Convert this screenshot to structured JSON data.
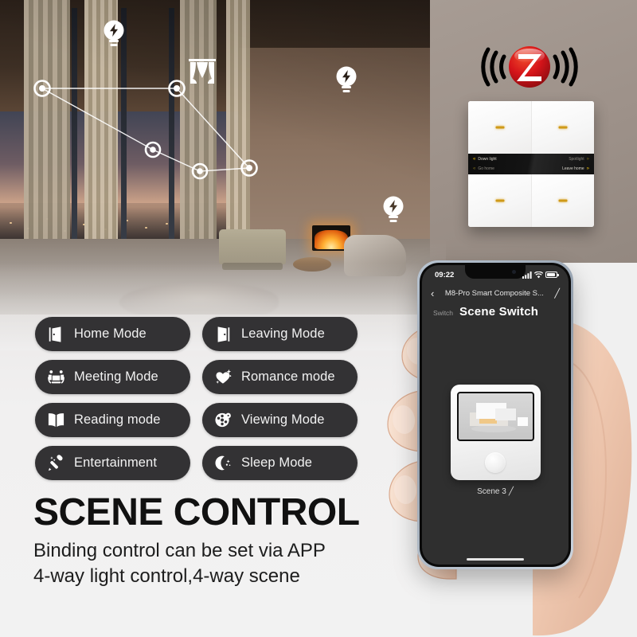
{
  "headline": "SCENE CONTROL",
  "subtitle_line1": "Binding control can be set via APP",
  "subtitle_line2": "4-way light control,4-way scene",
  "colors": {
    "pill_bg": "#333234",
    "pill_text": "#f2f2f2",
    "headline": "#111111",
    "zigbee_red": "#d0191b",
    "switch_accent": "#cf9a18",
    "switch_label_gold": "#f2c20a",
    "page_bg": "#f0f0f0",
    "taupe_bg": "#a39890"
  },
  "scene_modes": [
    {
      "label": "Home Mode",
      "icon": "door-open-icon"
    },
    {
      "label": "Leaving Mode",
      "icon": "door-exit-icon"
    },
    {
      "label": "Meeting Mode",
      "icon": "meeting-table-icon"
    },
    {
      "label": "Romance mode",
      "icon": "heart-sparkle-icon"
    },
    {
      "label": "Reading mode",
      "icon": "open-book-icon"
    },
    {
      "label": "Viewing Mode",
      "icon": "film-reel-icon"
    },
    {
      "label": "Entertainment",
      "icon": "microphone-icon"
    },
    {
      "label": "Sleep Mode",
      "icon": "moon-stars-icon"
    }
  ],
  "room_overlay": {
    "bulb_icons": [
      "bulb-icon",
      "bulb-icon",
      "bulb-icon"
    ],
    "curtain_icon": "curtain-icon",
    "nodes": 5,
    "node_icon": "mesh-node-icon"
  },
  "zigbee": {
    "logo_letter": "Z",
    "icon": "zigbee-logo-icon",
    "wave_icon": "signal-wave-icon"
  },
  "wall_switch": {
    "labels": [
      {
        "text": "Down light",
        "side": "left",
        "chevron": "«",
        "active": true
      },
      {
        "text": "Spotlight",
        "side": "right",
        "chevron": "»",
        "active": false
      },
      {
        "text": "Go home",
        "side": "left",
        "chevron": "«",
        "active": false
      },
      {
        "text": "Leave home",
        "side": "right",
        "chevron": "»",
        "active": true
      }
    ],
    "buttons": 4
  },
  "phone": {
    "status": {
      "time": "09:22",
      "signal_icon": "cellular-signal-icon",
      "wifi_icon": "wifi-icon",
      "battery_icon": "battery-icon"
    },
    "nav": {
      "back_icon": "chevron-left-icon",
      "title": "M8-Pro Smart Composite S...",
      "edit_icon": "pencil-icon"
    },
    "tabs": [
      {
        "label": "Switch",
        "active": false
      },
      {
        "label": "Scene Switch",
        "active": true
      }
    ],
    "scene_card": {
      "label": "Scene 3",
      "edit_icon": "pencil-icon",
      "thumbnail_icon": "smart-home-render-icon",
      "button_icon": "round-push-button-icon"
    }
  }
}
